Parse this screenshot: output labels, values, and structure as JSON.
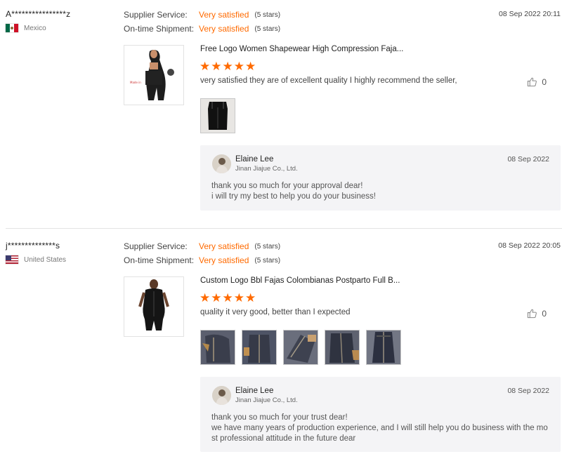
{
  "labels": {
    "supplier_service": "Supplier Service:",
    "ontime_shipment": "On-time Shipment:"
  },
  "reviews": [
    {
      "buyer": "A****************z",
      "country": "Mexico",
      "flag": "flag-mexico-icon",
      "supplier_service": "Very satisfied",
      "supplier_service_stars": "(5 stars)",
      "ontime_shipment": "Very satisfied",
      "ontime_shipment_stars": "(5 stars)",
      "date": "08 Sep 2022 20:11",
      "product_title": "Free Logo Women Shapewear High Compression Faja...",
      "rating": 5,
      "comment": "very satisfied they are of excellent quality I highly recommend the seller,",
      "helpful_count": "0",
      "photo_count": 1,
      "reply": {
        "name": "Elaine Lee",
        "company": "Jinan Jiajue Co., Ltd.",
        "date": "08 Sep 2022",
        "lines": [
          "thank you so much for your approval dear!",
          "i will try my best to help you do your business!"
        ]
      }
    },
    {
      "buyer": "j**************s",
      "country": "United States",
      "flag": "flag-united-states-icon",
      "supplier_service": "Very satisfied",
      "supplier_service_stars": "(5 stars)",
      "ontime_shipment": "Very satisfied",
      "ontime_shipment_stars": "(5 stars)",
      "date": "08 Sep 2022 20:05",
      "product_title": "Custom Logo Bbl Fajas Colombianas Postparto Full B...",
      "rating": 5,
      "comment": "quality it very good, better than I expected",
      "helpful_count": "0",
      "photo_count": 5,
      "reply": {
        "name": "Elaine Lee",
        "company": "Jinan Jiajue Co., Ltd.",
        "date": "08 Sep 2022",
        "lines": [
          "thank you so much for your trust dear!",
          "we have many years of production experience, and I will still help you do business with the mo",
          "st professional attitude in the future dear"
        ]
      }
    }
  ],
  "colors": {
    "accent": "#ff6a00",
    "reply_bg": "#f4f4f6",
    "divider": "#e3e3e3"
  }
}
